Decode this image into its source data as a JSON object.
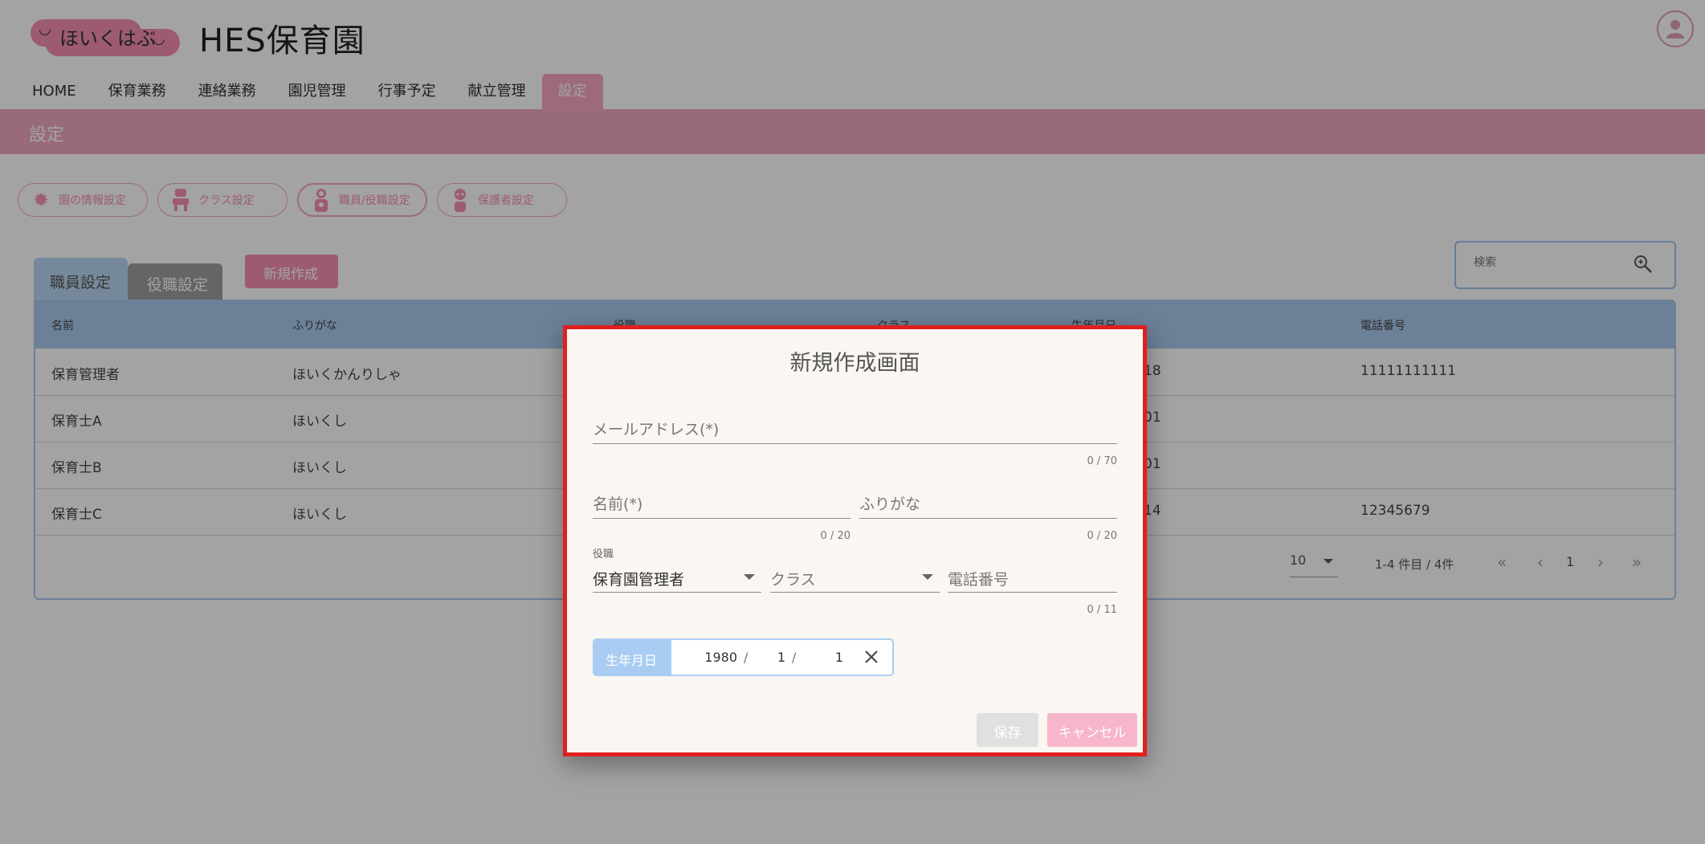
{
  "header": {
    "logo_text": "ほいくはぶ",
    "app_title": "HES保育園"
  },
  "nav": [
    "HOME",
    "保育業務",
    "連絡業務",
    "園児管理",
    "行事予定",
    "献立管理",
    "設定"
  ],
  "section_bar": {
    "title": "設定"
  },
  "setting_chips": [
    {
      "label": "園の情報設定",
      "icon": "gear-icon"
    },
    {
      "label": "クラス設定",
      "icon": "class-icon"
    },
    {
      "label": "職員/役職設定",
      "icon": "staff-icon"
    },
    {
      "label": "保護者設定",
      "icon": "guardian-icon"
    }
  ],
  "tabs": {
    "staff": "職員設定",
    "role": "役職設定"
  },
  "new_button": "新規作成",
  "search": {
    "placeholder": "検索"
  },
  "table": {
    "headers": [
      "名前",
      "ふりがな",
      "役職",
      "クラス",
      "生年月日",
      "電話番号"
    ],
    "rows": [
      {
        "name": "保育管理者",
        "kana": "ほいくかんりしゃ",
        "birth_tail": "18",
        "phone": "11111111111"
      },
      {
        "name": "保育士A",
        "kana": "ほいくし",
        "birth_tail": "01",
        "phone": ""
      },
      {
        "name": "保育士B",
        "kana": "ほいくし",
        "birth_tail": "01",
        "phone": ""
      },
      {
        "name": "保育士C",
        "kana": "ほいくし",
        "birth_tail": "14",
        "phone": "12345679"
      }
    ]
  },
  "pagination": {
    "page_size": "10",
    "range": "1-4 件目 / 4件",
    "current_page": "1"
  },
  "dialog": {
    "title": "新規作成画面",
    "email": {
      "placeholder": "メールアドレス(*)",
      "counter": "0 / 70"
    },
    "name": {
      "placeholder": "名前(*)",
      "counter": "0 / 20"
    },
    "kana": {
      "placeholder": "ふりがな",
      "counter": "0 / 20"
    },
    "role": {
      "label": "役職",
      "value": "保育園管理者"
    },
    "class": {
      "placeholder": "クラス"
    },
    "phone": {
      "placeholder": "電話番号",
      "counter": "0 / 11"
    },
    "birth": {
      "label": "生年月日",
      "year": "1980",
      "month": "1",
      "day": "1"
    },
    "save": "保存",
    "cancel": "キャンセル"
  },
  "colors": {
    "accent_pink": "#f48fb1",
    "accent_blue": "#a9cdf2",
    "highlight_border": "#e0201f"
  }
}
